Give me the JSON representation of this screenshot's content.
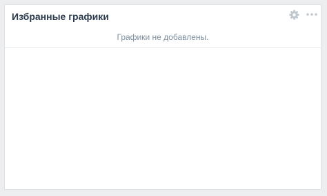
{
  "widget": {
    "title": "Избранные графики",
    "empty_message": "Графики не добавлены.",
    "icons": {
      "settings": "gear-icon",
      "more": "more-icon"
    },
    "colors": {
      "background": "#edeef0",
      "panel": "#ffffff",
      "title_text": "#2b3a4d",
      "muted_text": "#7e8f9f",
      "icon": "#c1c8d0"
    }
  }
}
